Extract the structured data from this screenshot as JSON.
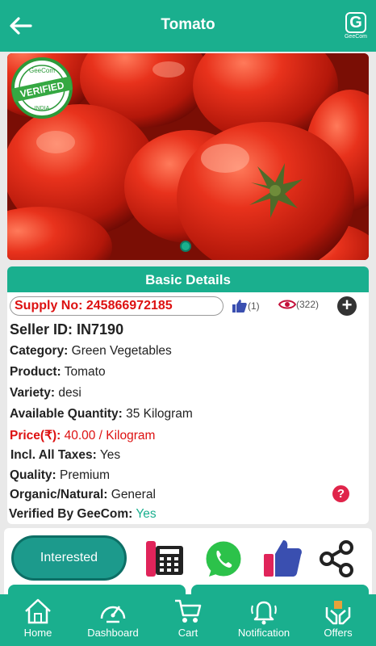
{
  "header": {
    "title": "Tomato",
    "logo_text": "GeeCom"
  },
  "badge": {
    "top": "GeeCom",
    "main": "VERIFIED",
    "bottom": "INDIA"
  },
  "details": {
    "section_title": "Basic Details",
    "supply": "Supply No: 245866972185",
    "likes": "(1)",
    "views": "(322)",
    "seller": "Seller ID: IN7190",
    "rows": [
      {
        "label": "Category:",
        "value": " Green Vegetables"
      },
      {
        "label": "Product:",
        "value": " Tomato"
      },
      {
        "label": "Variety:",
        "value": " desi"
      },
      {
        "label": "Available Quantity:",
        "value": " 35 Kilogram"
      },
      {
        "label": "Price(₹):",
        "value": "  40.00 / Kilogram"
      },
      {
        "label": "Incl. All Taxes:",
        "value": " Yes"
      },
      {
        "label": "Quality:",
        "value": " Premium"
      },
      {
        "label": "Organic/Natural:",
        "value": "  General"
      },
      {
        "label": "Verified By GeeCom:",
        "value": " Yes"
      }
    ]
  },
  "actions": {
    "interested": "Interested"
  },
  "nav": [
    {
      "label": "Home",
      "icon": "home-icon"
    },
    {
      "label": "Dashboard",
      "icon": "speedometer-icon"
    },
    {
      "label": "Cart",
      "icon": "cart-icon"
    },
    {
      "label": "Notification",
      "icon": "bell-icon"
    },
    {
      "label": "Offers",
      "icon": "offer-hands-icon"
    }
  ],
  "colors": {
    "primary": "#1aaf8e",
    "accent_red": "#d11111"
  }
}
